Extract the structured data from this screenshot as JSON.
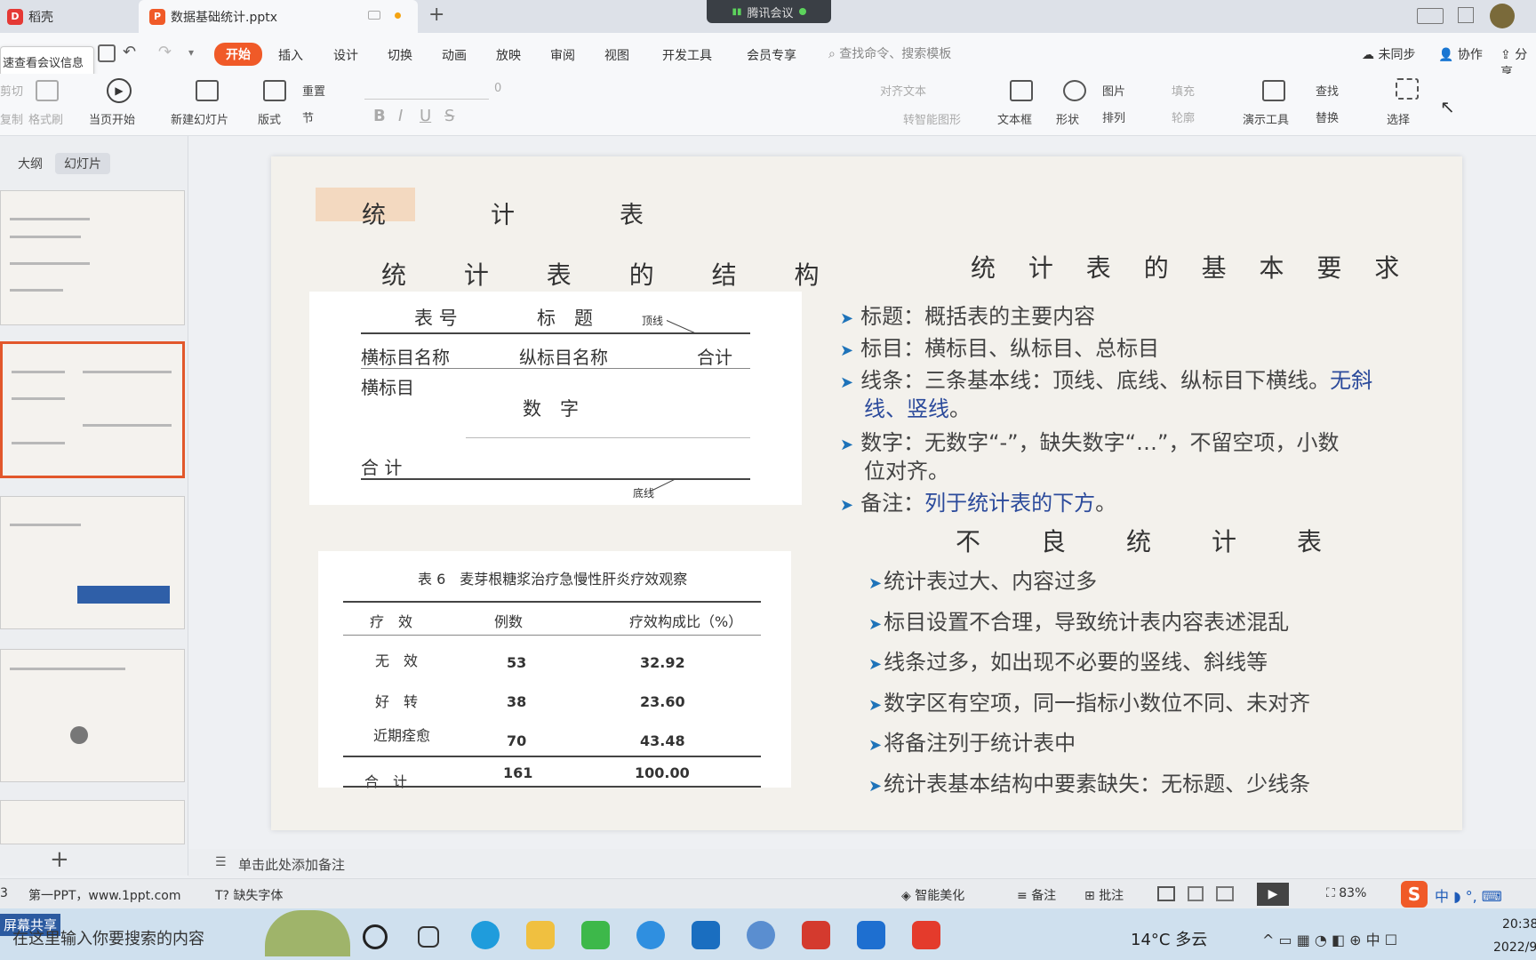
{
  "titlebar": {
    "tabs": [
      {
        "label": "稻壳"
      },
      {
        "label": "数据基础统计.pptx"
      }
    ],
    "meeting_label": "腾讯会议"
  },
  "menubar": {
    "tooltip": "速查看会议信息",
    "items": [
      "开始",
      "插入",
      "设计",
      "切换",
      "动画",
      "放映",
      "审阅",
      "视图",
      "开发工具",
      "会员专享"
    ],
    "search_placeholder": "查找命令、搜索模板",
    "right": [
      "未同步",
      "协作",
      "分享"
    ]
  },
  "ribbon": {
    "groups": {
      "cut": "剪切",
      "copy": "复制",
      "format_painter": "格式刷",
      "play_current": "当页开始",
      "new_slide": "新建幻灯片",
      "layout": "版式",
      "reset": "重置",
      "section": "节",
      "font_size": "0",
      "align_text": "对齐文本",
      "smart_shape": "转智能图形",
      "textbox": "文本框",
      "shape": "形状",
      "picture": "图片",
      "fill": "填充",
      "arrange": "排列",
      "outline": "轮廓",
      "present_tools": "演示工具",
      "find": "查找",
      "replace": "替换",
      "select": "选择"
    }
  },
  "leftpanel": {
    "tabs": [
      "大纲",
      "幻灯片"
    ],
    "add_label": "+"
  },
  "slide": {
    "title": "统　　　　计　　　　表",
    "left": {
      "structure_title": "统 计 表 的 结 构",
      "struct_table": {
        "header_num": "表 号",
        "header_title": "标　题",
        "top_line": "顶线",
        "col1": "横标目名称",
        "col2": "纵标目名称",
        "col3": "合计",
        "row_label": "横标目",
        "digits": "数　字",
        "total": "合 计",
        "bottom_line": "底线"
      },
      "example_table": {
        "caption": "表 6　麦芽根糖浆治疗急慢性肝炎疗效观察",
        "headers": [
          "疗　效",
          "例数",
          "疗效构成比（%）"
        ],
        "rows": [
          [
            "无　效",
            "53",
            "32.92"
          ],
          [
            "好　转",
            "38",
            "23.60"
          ],
          [
            "近期痊愈",
            "70",
            "43.48"
          ]
        ],
        "total": [
          "合　计",
          "161",
          "100.00"
        ]
      }
    },
    "right": {
      "req_title": "统 计 表 的 基 本 要 求",
      "req_items": [
        {
          "prefix": "标题：",
          "text": "概括表的主要内容"
        },
        {
          "prefix": "标目：",
          "text": "横标目、纵标目、总标目"
        },
        {
          "prefix": "线条：",
          "text": "三条基本线：顶线、底线、纵标目下横线。",
          "highlight": "无斜",
          "line2_highlight": "线、竖线",
          "line2_tail": "。"
        },
        {
          "prefix": "数字：",
          "text": "无数字“-”，缺失数字“…”，不留空项，小数",
          "line2": "位对齐。"
        },
        {
          "prefix": "备注：",
          "highlight": "列于统计表的下方",
          "tail": "。"
        }
      ],
      "bad_title": "不　　良　　统　　计　　表",
      "bad_items": [
        "统计表过大、内容过多",
        "标目设置不合理，导致统计表内容表述混乱",
        "线条过多，如出现不必要的竖线、斜线等",
        "数字区有空项，同一指标小数位不同、未对齐",
        "将备注列于统计表中",
        "统计表基本结构中要素缺失：无标题、少线条"
      ]
    }
  },
  "notes": {
    "placeholder": "单击此处添加备注"
  },
  "statusbar": {
    "slide_num": "3",
    "theme": "第一PPT，www.1ppt.com",
    "missing_font": "缺失字体",
    "beautify": "智能美化",
    "notes": "备注",
    "comments": "批注",
    "zoom": "83%"
  },
  "taskbar": {
    "share_label": "屏幕共享",
    "search_placeholder": "在这里输入你要搜索的内容",
    "weather": "14°C 多云",
    "time": "20:38",
    "date": "2022/9"
  },
  "colors": {
    "accent": "#f05a28",
    "selected_border": "#e2572b",
    "bullet": "#1e73b9",
    "highlight_text": "#2b4a9b"
  }
}
